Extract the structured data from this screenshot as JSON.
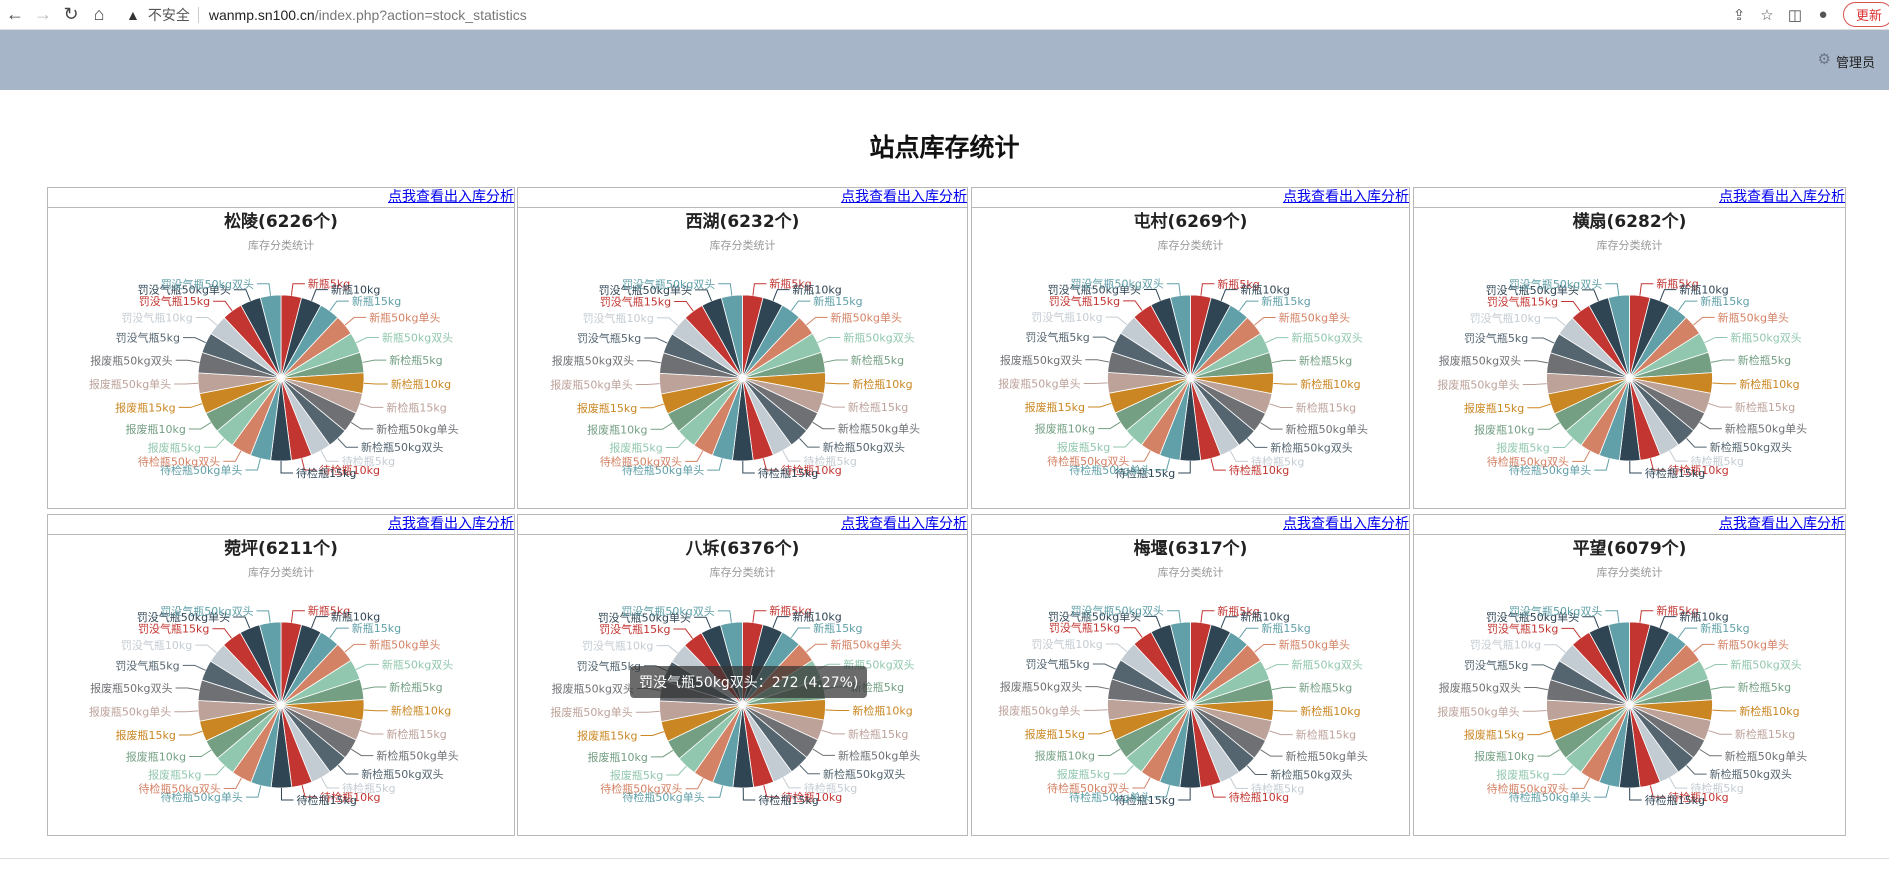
{
  "browser": {
    "back_icon": "arrow-left-icon",
    "forward_icon": "arrow-right-icon",
    "insecure_label": "不安全",
    "url_host": "wanmp.sn100.cn",
    "url_path": "/index.php?action=stock_statistics",
    "update_label": "更新"
  },
  "header": {
    "admin_label": "管理员"
  },
  "page": {
    "title": "站点库存统计"
  },
  "link_text": "点我查看出入库分析",
  "tooltip": {
    "text": "罚没气瓶50kg双头：272 (4.27%)"
  },
  "colors": [
    "#c23531",
    "#2f4554",
    "#61a0a8",
    "#d48265",
    "#91c7ae",
    "#749f83",
    "#ca8622",
    "#bda29a",
    "#6e7074",
    "#546570",
    "#c4ccd3"
  ],
  "chart_data": [
    {
      "type": "pie",
      "title": "松陵(6226个)",
      "subtitle": "库存分类统计",
      "categories": [
        "新瓶5kg",
        "新瓶10kg",
        "新瓶15kg",
        "新瓶50kg单头",
        "新瓶50kg双头",
        "新检瓶5kg",
        "新检瓶10kg",
        "新检瓶15kg",
        "新检瓶50kg单头",
        "新检瓶50kg双头",
        "待检瓶5kg",
        "待检瓶10kg",
        "待检瓶15kg",
        "待检瓶50kg单头",
        "待检瓶50kg双头",
        "报废瓶5kg",
        "报废瓶10kg",
        "报废瓶15kg",
        "报废瓶50kg单头",
        "报废瓶50kg双头",
        "罚没气瓶5kg",
        "罚没气瓶10kg",
        "罚没气瓶15kg",
        "罚没气瓶50kg单头",
        "罚没气瓶50kg双头"
      ],
      "values": [
        249,
        249,
        249,
        249,
        249,
        249,
        249,
        249,
        249,
        249,
        249,
        249,
        249,
        249,
        249,
        249,
        249,
        249,
        249,
        249,
        249,
        249,
        249,
        249,
        250
      ]
    },
    {
      "type": "pie",
      "title": "西湖(6232个)",
      "subtitle": "库存分类统计",
      "categories": [
        "新瓶5kg",
        "新瓶10kg",
        "新瓶15kg",
        "新瓶50kg单头",
        "新瓶50kg双头",
        "新检瓶5kg",
        "新检瓶10kg",
        "新检瓶15kg",
        "新检瓶50kg单头",
        "新检瓶50kg双头",
        "待检瓶5kg",
        "待检瓶10kg",
        "待检瓶15kg",
        "待检瓶50kg单头",
        "待检瓶50kg双头",
        "报废瓶5kg",
        "报废瓶10kg",
        "报废瓶15kg",
        "报废瓶50kg单头",
        "报废瓶50kg双头",
        "罚没气瓶5kg",
        "罚没气瓶10kg",
        "罚没气瓶15kg",
        "罚没气瓶50kg单头",
        "罚没气瓶50kg双头"
      ],
      "values": [
        249,
        249,
        249,
        249,
        249,
        249,
        249,
        249,
        249,
        249,
        249,
        249,
        249,
        249,
        249,
        249,
        249,
        249,
        249,
        249,
        249,
        249,
        249,
        250,
        255
      ]
    },
    {
      "type": "pie",
      "title": "屯村(6269个)",
      "subtitle": "库存分类统计",
      "categories": [
        "新瓶5kg",
        "新瓶10kg",
        "新瓶15kg",
        "新瓶50kg单头",
        "新瓶50kg双头",
        "新检瓶5kg",
        "新检瓶10kg",
        "新检瓶15kg",
        "新检瓶50kg单头",
        "新检瓶50kg双头",
        "待检瓶5kg",
        "待检瓶10kg",
        "待检瓶15kg",
        "待检瓶50kg单头",
        "待检瓶50kg双头",
        "报废瓶5kg",
        "报废瓶10kg",
        "报废瓶15kg",
        "报废瓶50kg单头",
        "报废瓶50kg双头",
        "罚没气瓶5kg",
        "罚没气瓶10kg",
        "罚没气瓶15kg",
        "罚没气瓶50kg单头",
        "罚没气瓶50kg双头"
      ],
      "values": [
        251,
        251,
        251,
        251,
        251,
        251,
        251,
        251,
        251,
        251,
        251,
        251,
        251,
        251,
        251,
        251,
        251,
        251,
        251,
        251,
        251,
        251,
        251,
        251,
        245
      ]
    },
    {
      "type": "pie",
      "title": "横扇(6282个)",
      "subtitle": "库存分类统计",
      "categories": [
        "新瓶5kg",
        "新瓶10kg",
        "新瓶15kg",
        "新瓶50kg单头",
        "新瓶50kg双头",
        "新检瓶5kg",
        "新检瓶10kg",
        "新检瓶15kg",
        "新检瓶50kg单头",
        "新检瓶50kg双头",
        "待检瓶5kg",
        "待检瓶10kg",
        "待检瓶15kg",
        "待检瓶50kg单头",
        "待检瓶50kg双头",
        "报废瓶5kg",
        "报废瓶10kg",
        "报废瓶15kg",
        "报废瓶50kg单头",
        "报废瓶50kg双头",
        "罚没气瓶5kg",
        "罚没气瓶10kg",
        "罚没气瓶15kg",
        "罚没气瓶50kg单头",
        "罚没气瓶50kg双头"
      ],
      "values": [
        251,
        251,
        251,
        251,
        251,
        251,
        251,
        251,
        251,
        251,
        251,
        251,
        251,
        251,
        251,
        251,
        251,
        251,
        251,
        251,
        251,
        251,
        251,
        251,
        258
      ]
    },
    {
      "type": "pie",
      "title": "菀坪(6211个)",
      "subtitle": "库存分类统计",
      "categories": [
        "新瓶5kg",
        "新瓶10kg",
        "新瓶15kg",
        "新瓶50kg单头",
        "新瓶50kg双头",
        "新检瓶5kg",
        "新检瓶10kg",
        "新检瓶15kg",
        "新检瓶50kg单头",
        "新检瓶50kg双头",
        "待检瓶5kg",
        "待检瓶10kg",
        "待检瓶15kg",
        "待检瓶50kg单头",
        "待检瓶50kg双头",
        "报废瓶5kg",
        "报废瓶10kg",
        "报废瓶15kg",
        "报废瓶50kg单头",
        "报废瓶50kg双头",
        "罚没气瓶5kg",
        "罚没气瓶10kg",
        "罚没气瓶15kg",
        "罚没气瓶50kg单头",
        "罚没气瓶50kg双头"
      ],
      "values": [
        248,
        248,
        248,
        248,
        248,
        248,
        248,
        248,
        248,
        248,
        248,
        248,
        248,
        248,
        248,
        248,
        248,
        248,
        248,
        248,
        248,
        248,
        248,
        248,
        259
      ]
    },
    {
      "type": "pie",
      "title": "八坼(6376个)",
      "subtitle": "库存分类统计",
      "categories": [
        "新瓶5kg",
        "新瓶10kg",
        "新瓶15kg",
        "新瓶50kg单头",
        "新瓶50kg双头",
        "新检瓶5kg",
        "新检瓶10kg",
        "新检瓶15kg",
        "新检瓶50kg单头",
        "新检瓶50kg双头",
        "待检瓶5kg",
        "待检瓶10kg",
        "待检瓶15kg",
        "待检瓶50kg单头",
        "待检瓶50kg双头",
        "报废瓶5kg",
        "报废瓶10kg",
        "报废瓶15kg",
        "报废瓶50kg单头",
        "报废瓶50kg双头",
        "罚没气瓶5kg",
        "罚没气瓶10kg",
        "罚没气瓶15kg",
        "罚没气瓶50kg单头",
        "罚没气瓶50kg双头"
      ],
      "values": [
        254,
        254,
        254,
        254,
        254,
        254,
        254,
        254,
        254,
        254,
        254,
        254,
        254,
        254,
        254,
        254,
        254,
        254,
        254,
        254,
        254,
        254,
        254,
        254,
        272
      ]
    },
    {
      "type": "pie",
      "title": "梅堰(6317个)",
      "subtitle": "库存分类统计",
      "categories": [
        "新瓶5kg",
        "新瓶10kg",
        "新瓶15kg",
        "新瓶50kg单头",
        "新瓶50kg双头",
        "新检瓶5kg",
        "新检瓶10kg",
        "新检瓶15kg",
        "新检瓶50kg单头",
        "新检瓶50kg双头",
        "待检瓶5kg",
        "待检瓶10kg",
        "待检瓶15kg",
        "待检瓶50kg单头",
        "待检瓶50kg双头",
        "报废瓶5kg",
        "报废瓶10kg",
        "报废瓶15kg",
        "报废瓶50kg单头",
        "报废瓶50kg双头",
        "罚没气瓶5kg",
        "罚没气瓶10kg",
        "罚没气瓶15kg",
        "罚没气瓶50kg单头",
        "罚没气瓶50kg双头"
      ],
      "values": [
        253,
        253,
        253,
        253,
        253,
        253,
        253,
        253,
        253,
        253,
        253,
        253,
        253,
        253,
        253,
        253,
        253,
        253,
        253,
        253,
        253,
        253,
        253,
        253,
        245
      ]
    },
    {
      "type": "pie",
      "title": "平望(6079个)",
      "subtitle": "库存分类统计",
      "categories": [
        "新瓶5kg",
        "新瓶10kg",
        "新瓶15kg",
        "新瓶50kg单头",
        "新瓶50kg双头",
        "新检瓶5kg",
        "新检瓶10kg",
        "新检瓶15kg",
        "新检瓶50kg单头",
        "新检瓶50kg双头",
        "待检瓶5kg",
        "待检瓶10kg",
        "待检瓶15kg",
        "待检瓶50kg单头",
        "待检瓶50kg双头",
        "报废瓶5kg",
        "报废瓶10kg",
        "报废瓶15kg",
        "报废瓶50kg单头",
        "报废瓶50kg双头",
        "罚没气瓶5kg",
        "罚没气瓶10kg",
        "罚没气瓶15kg",
        "罚没气瓶50kg单头",
        "罚没气瓶50kg双头"
      ],
      "values": [
        243,
        243,
        243,
        243,
        243,
        243,
        243,
        243,
        243,
        243,
        243,
        243,
        243,
        243,
        243,
        243,
        243,
        243,
        243,
        243,
        243,
        243,
        243,
        243,
        247
      ]
    }
  ]
}
